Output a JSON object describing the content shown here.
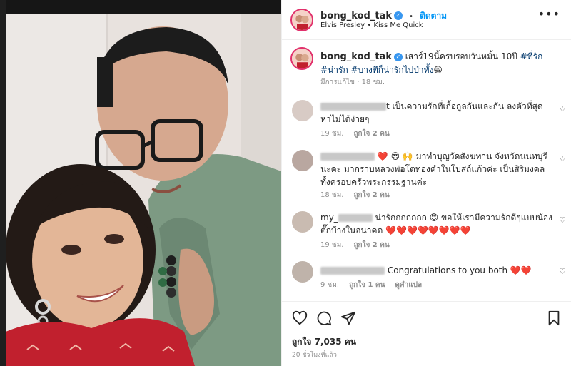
{
  "post": {
    "username": "bong_kod_tak",
    "follow_label": "ติดตาม",
    "separator": "•",
    "music": "Elvis Presley • Kiss Me Quick",
    "more_label": "•••"
  },
  "caption": {
    "username": "bong_kod_tak",
    "text": " เสาร์19นี้ครบรอบวันหมั้น 10ปี ",
    "tag1": "#ที่รัก",
    "tag2": "#น่ารัก",
    "tag3": "#บางทีก็น่ารักไปป่าทั้ง",
    "emoji": "😁",
    "edited": "มีการแก้ไข",
    "dot": "·",
    "time": "18 ชม."
  },
  "comments": [
    {
      "text": "t เป็นความรักที่เกื้อกูลกันและกัน ลงตัวที่สุด หาไม่ได้ง่ายๆ",
      "time": "19 ชม.",
      "likes": "ถูกใจ 2 คน"
    },
    {
      "emojis": "❤️ 😍 🙌",
      "text": "มาทำบุญวัดสังฆทาน จังหวัดนนทบุรีนะคะ มากราบหลวงพ่อโตทองคำในโบสถ์แก้วค่ะ เป็นสิริมงคลทั้งครอบครัวพระกรรมฐานค่ะ",
      "time": "18 ชม.",
      "likes": "ถูกใจ 2 คน"
    },
    {
      "prefix": "my_",
      "text": "น่ารักกกกกกก 😍 ขอให้เรามีความรักดีๆแบบน้องตั๊กบ้างในอนาคต ",
      "hearts": "❤️❤️❤️❤️❤️❤️❤️❤️",
      "time": "19 ชม.",
      "likes": "ถูกใจ 2 คน"
    },
    {
      "text": "Congratulations to you both ",
      "hearts": "❤️❤️",
      "time": "9 ชม.",
      "likes": "ถูกใจ 1 คน",
      "translate": "ดูคำแปล"
    }
  ],
  "footer": {
    "likes": "ถูกใจ 7,035 คน",
    "time_ago": "20 ชั่วโมงที่แล้ว"
  },
  "colors": {
    "link": "#0095f6",
    "hashtag": "#00376b",
    "heart": "#ed4956",
    "muted": "#8e8e8e"
  },
  "icons": [
    "verified-icon",
    "heart-icon",
    "comment-icon",
    "share-icon",
    "bookmark-icon",
    "more-icon"
  ]
}
